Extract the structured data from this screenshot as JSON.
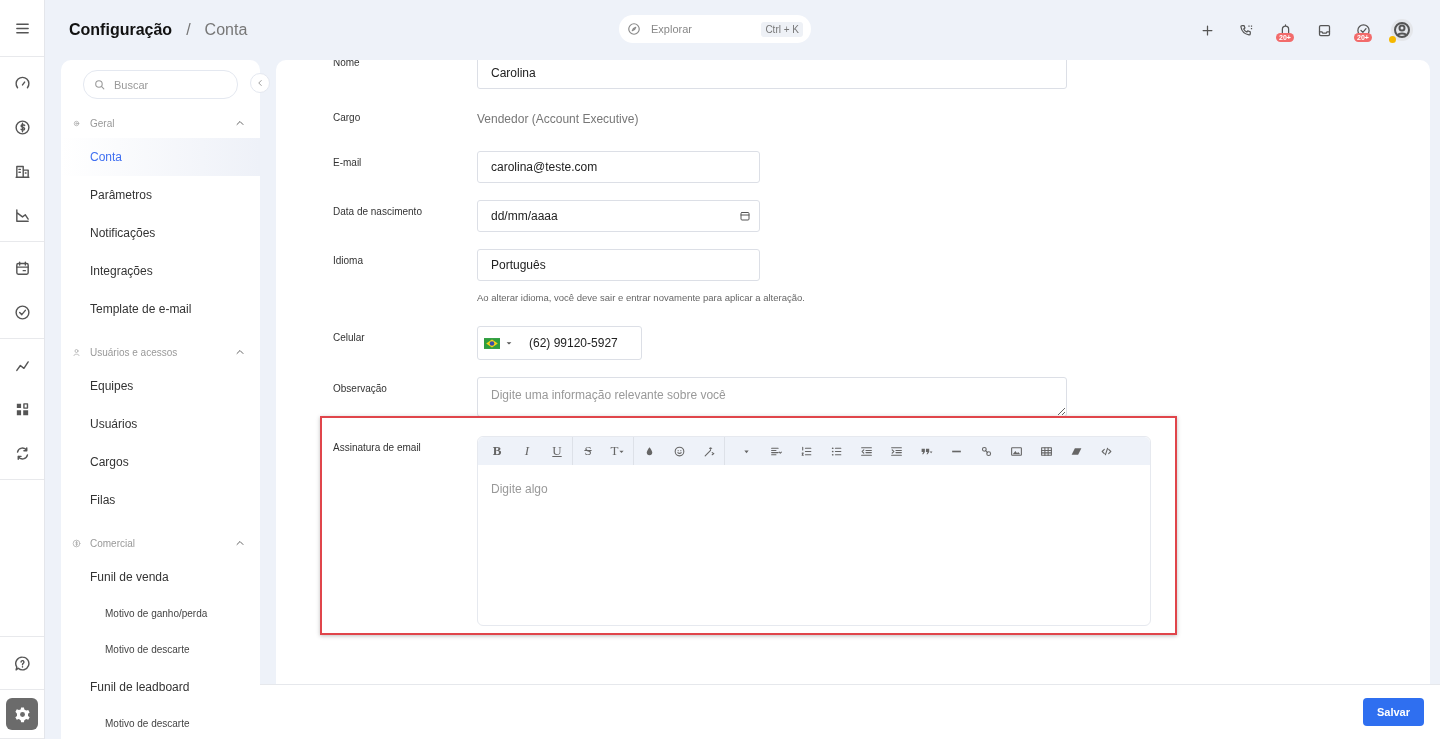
{
  "rail_groups": [
    [
      {
        "kind": "menu",
        "selected": false
      }
    ],
    [
      {
        "kind": "gauge",
        "selected": false
      },
      {
        "kind": "dollar",
        "selected": false
      },
      {
        "kind": "building",
        "selected": false
      },
      {
        "kind": "chart",
        "selected": false
      }
    ],
    [
      {
        "kind": "calendar",
        "selected": false
      },
      {
        "kind": "check",
        "selected": false
      }
    ],
    [
      {
        "kind": "trend",
        "selected": false
      },
      {
        "kind": "widgets",
        "selected": false
      },
      {
        "kind": "sync",
        "selected": false
      }
    ]
  ],
  "rail_bottom": [
    {
      "kind": "help",
      "selected": false
    },
    {
      "kind": "settings",
      "selected": true
    }
  ],
  "breadcrumb": {
    "section": "Configuração",
    "separator": "/",
    "page": "Conta"
  },
  "explore": {
    "placeholder": "Explorar",
    "shortcut": "Ctrl + K"
  },
  "header_actions": [
    {
      "kind": "plus"
    },
    {
      "kind": "phone"
    },
    {
      "kind": "bell",
      "badge": "20+"
    },
    {
      "kind": "inbox"
    },
    {
      "kind": "task",
      "badge": "20+"
    },
    {
      "kind": "avatar",
      "color": "#f5b800"
    }
  ],
  "sidebar": {
    "search_placeholder": "Buscar",
    "groups": [
      {
        "kind": "gear",
        "label": "Geral",
        "expanded": true,
        "items": [
          {
            "label": "Conta",
            "selected": true
          },
          {
            "label": "Parâmetros",
            "selected": false
          },
          {
            "label": "Notificações",
            "selected": false
          },
          {
            "label": "Integrações",
            "selected": false
          },
          {
            "label": "Template de e-mail",
            "selected": false
          }
        ]
      },
      {
        "kind": "user",
        "label": "Usuários e acessos",
        "expanded": true,
        "items": [
          {
            "label": "Equipes",
            "selected": false
          },
          {
            "label": "Usuários",
            "selected": false
          },
          {
            "label": "Cargos",
            "selected": false
          },
          {
            "label": "Filas",
            "selected": false
          }
        ]
      },
      {
        "kind": "dollar",
        "label": "Comercial",
        "expanded": true,
        "items": [
          {
            "label": "Funil de venda",
            "selected": false,
            "children": [
              {
                "label": "Motivo de ganho/perda",
                "selected": false
              },
              {
                "label": "Motivo de descarte",
                "selected": false
              }
            ]
          },
          {
            "label": "Funil de leadboard",
            "selected": false,
            "children": [
              {
                "label": "Motivo de descarte",
                "selected": false
              }
            ]
          }
        ]
      }
    ]
  },
  "form": {
    "fields": [
      {
        "kind": "input",
        "label": "Nome",
        "value": "Carolina"
      },
      {
        "kind": "static",
        "label": "Cargo",
        "value": "Vendedor (Account Executive)"
      },
      {
        "kind": "input",
        "label": "E-mail",
        "value": "carolina@teste.com"
      },
      {
        "kind": "date",
        "label": "Data de nascimento",
        "placeholder": "dd/mm/aaaa"
      },
      {
        "kind": "input",
        "label": "Idioma",
        "value": "Português",
        "hint": "Ao alterar idioma, você deve sair e entrar novamente para aplicar a alteração."
      },
      {
        "kind": "phone",
        "label": "Celular",
        "value": "(62) 99120-5927"
      },
      {
        "kind": "textarea",
        "label": "Observação",
        "placeholder": "Digite uma informação relevante sobre você"
      },
      {
        "kind": "editor",
        "label": "Assinatura de email",
        "placeholder": "Digite algo",
        "highlighted": true,
        "toolbar": [
          [
            {
              "kind": "bold",
              "label": "B"
            },
            {
              "kind": "italic",
              "label": "I"
            },
            {
              "kind": "underline",
              "label": "U"
            }
          ],
          [
            {
              "kind": "strike",
              "label": "S"
            },
            {
              "kind": "size",
              "label": "T"
            }
          ],
          [
            {
              "kind": "color"
            },
            {
              "kind": "emoji"
            },
            {
              "kind": "magic"
            }
          ],
          [
            {
              "kind": "dropdown"
            },
            {
              "kind": "align"
            },
            {
              "kind": "ol"
            },
            {
              "kind": "ul"
            },
            {
              "kind": "outdent"
            },
            {
              "kind": "indent"
            },
            {
              "kind": "quote"
            },
            {
              "kind": "hr"
            },
            {
              "kind": "link"
            },
            {
              "kind": "image"
            },
            {
              "kind": "table"
            },
            {
              "kind": "eraser"
            },
            {
              "kind": "code"
            }
          ]
        ]
      }
    ]
  },
  "save_button": "Salvar"
}
